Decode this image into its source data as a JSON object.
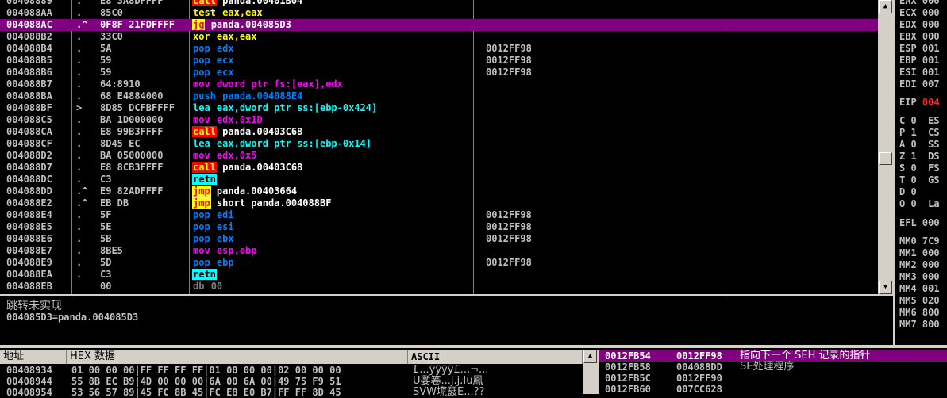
{
  "disasm": {
    "rows": [
      {
        "addr": "00408889",
        "mark": ".",
        "hex": "E8 3A8DFFFF",
        "mnem": "call",
        "mtype": "call",
        "ops": "panda.00401B04",
        "cmt": ""
      },
      {
        "addr": "004088AA",
        "mark": ".",
        "hex": "85C0",
        "mnem": "test",
        "mtype": "plain",
        "ops": "eax,eax",
        "cmt": ""
      },
      {
        "addr": "004088AC",
        "mark": ".^",
        "hex": "0F8F 21FDFFFF",
        "mnem": "jg",
        "mtype": "jmp",
        "ops": "panda.004085D3",
        "cmt": "",
        "sel": true
      },
      {
        "addr": "004088B2",
        "mark": ".",
        "hex": "33C0",
        "mnem": "xor",
        "mtype": "plain",
        "ops": "eax,eax",
        "cmt": ""
      },
      {
        "addr": "004088B4",
        "mark": ".",
        "hex": "5A",
        "mnem": "pop",
        "mtype": "pop",
        "ops": "edx",
        "cmt": "0012FF98"
      },
      {
        "addr": "004088B5",
        "mark": ".",
        "hex": "59",
        "mnem": "pop",
        "mtype": "pop",
        "ops": "ecx",
        "cmt": "0012FF98"
      },
      {
        "addr": "004088B6",
        "mark": ".",
        "hex": "59",
        "mnem": "pop",
        "mtype": "pop",
        "ops": "ecx",
        "cmt": "0012FF98"
      },
      {
        "addr": "004088B7",
        "mark": ".",
        "hex": "64:8910",
        "mnem": "mov",
        "mtype": "mov",
        "ops": "dword ptr fs:[eax],edx",
        "cmt": ""
      },
      {
        "addr": "004088BA",
        "mark": ".",
        "hex": "68 E4884000",
        "mnem": "push",
        "mtype": "push",
        "ops": "panda.004088E4",
        "cmt": ""
      },
      {
        "addr": "004088BF",
        "mark": ">",
        "hex": "8D85 DCFBFFFF",
        "mnem": "lea",
        "mtype": "plain",
        "ops": "eax,dword ptr ss:[ebp-0x424]",
        "cmt": ""
      },
      {
        "addr": "004088C5",
        "mark": ".",
        "hex": "BA 1D000000",
        "mnem": "mov",
        "mtype": "mov",
        "ops": "edx,0x1D",
        "cmt": ""
      },
      {
        "addr": "004088CA",
        "mark": ".",
        "hex": "E8 99B3FFFF",
        "mnem": "call",
        "mtype": "call",
        "ops": "panda.00403C68",
        "cmt": ""
      },
      {
        "addr": "004088CF",
        "mark": ".",
        "hex": "8D45 EC",
        "mnem": "lea",
        "mtype": "plain",
        "ops": "eax,dword ptr ss:[ebp-0x14]",
        "cmt": ""
      },
      {
        "addr": "004088D2",
        "mark": ".",
        "hex": "BA 05000000",
        "mnem": "mov",
        "mtype": "mov",
        "ops": "edx,0x5",
        "cmt": ""
      },
      {
        "addr": "004088D7",
        "mark": ".",
        "hex": "E8 8CB3FFFF",
        "mnem": "call",
        "mtype": "call",
        "ops": "panda.00403C68",
        "cmt": ""
      },
      {
        "addr": "004088DC",
        "mark": ".",
        "hex": "C3",
        "mnem": "retn",
        "mtype": "ret",
        "ops": "",
        "cmt": ""
      },
      {
        "addr": "004088DD",
        "mark": ".^",
        "hex": "E9 82ADFFFF",
        "mnem": "jmp",
        "mtype": "jmp",
        "ops": "panda.00403664",
        "cmt": ""
      },
      {
        "addr": "004088E2",
        "mark": ".^",
        "hex": "EB DB",
        "mnem": "jmp",
        "mtype": "jmp",
        "ops": "short panda.004088BF",
        "cmt": ""
      },
      {
        "addr": "004088E4",
        "mark": ".",
        "hex": "5F",
        "mnem": "pop",
        "mtype": "pop",
        "ops": "edi",
        "cmt": "0012FF98"
      },
      {
        "addr": "004088E5",
        "mark": ".",
        "hex": "5E",
        "mnem": "pop",
        "mtype": "pop",
        "ops": "esi",
        "cmt": "0012FF98"
      },
      {
        "addr": "004088E6",
        "mark": ".",
        "hex": "5B",
        "mnem": "pop",
        "mtype": "pop",
        "ops": "ebx",
        "cmt": "0012FF98"
      },
      {
        "addr": "004088E7",
        "mark": ".",
        "hex": "8BE5",
        "mnem": "mov",
        "mtype": "mov",
        "ops": "esp,ebp",
        "cmt": ""
      },
      {
        "addr": "004088E9",
        "mark": ".",
        "hex": "5D",
        "mnem": "pop",
        "mtype": "pop",
        "ops": "ebp",
        "cmt": "0012FF98"
      },
      {
        "addr": "004088EA",
        "mark": ".",
        "hex": "C3",
        "mnem": "retn",
        "mtype": "ret",
        "ops": "",
        "cmt": ""
      },
      {
        "addr": "004088EB",
        "mark": "",
        "hex": "00",
        "mnem": "db",
        "mtype": "db",
        "ops": "00",
        "cmt": ""
      }
    ]
  },
  "info": {
    "line1": "跳转未实现",
    "line2": "004085D3=panda.004085D3"
  },
  "registers": [
    {
      "t": "EAX 000",
      "red": false
    },
    {
      "t": "ECX 000",
      "red": false
    },
    {
      "t": "EDX 000",
      "red": false
    },
    {
      "t": "EBX 000",
      "red": false
    },
    {
      "t": "ESP 001",
      "red": false
    },
    {
      "t": "EBP 001",
      "red": false
    },
    {
      "t": "ESI 001",
      "red": false
    },
    {
      "t": "EDI 007",
      "red": false
    },
    {
      "t": "EIP 004",
      "red": true
    },
    {
      "t": "C 0  ES",
      "red": false
    },
    {
      "t": "P 1  CS",
      "red": false
    },
    {
      "t": "A 0  SS",
      "red": false
    },
    {
      "t": "Z 1  DS",
      "red": false
    },
    {
      "t": "S 0  FS",
      "red": false
    },
    {
      "t": "T 0  GS",
      "red": false
    },
    {
      "t": "D 0",
      "red": false
    },
    {
      "t": "O 0  La",
      "red": false
    },
    {
      "t": "EFL 000",
      "red": false
    },
    {
      "t": "MM0 7C9",
      "red": false
    },
    {
      "t": "MM1 000",
      "red": false
    },
    {
      "t": "MM2 000",
      "red": false
    },
    {
      "t": "MM3 000",
      "red": false
    },
    {
      "t": "MM4 001",
      "red": false
    },
    {
      "t": "MM5 020",
      "red": false
    },
    {
      "t": "MM6 800",
      "red": false
    },
    {
      "t": "MM7 800",
      "red": false
    }
  ],
  "dump": {
    "headers": {
      "addr": "地址",
      "hex": "HEX 数据",
      "ascii": "ASCII"
    },
    "rows": [
      {
        "addr": "00408934",
        "hex": "01 00 00 00|FF FF FF FF|01 00 00 00|02 00 00 00",
        "ascii": "£...ÿÿÿÿ£...¬..."
      },
      {
        "addr": "00408944",
        "hex": "55 8B EC B9|4D 00 00 00|6A 00 6A 00|49 75 F9 51",
        "ascii": "U嬱箞...j.j.Iu鳳"
      },
      {
        "addr": "00408954",
        "hex": "53 56 57 89|45 FC 8B 45|FC E8 E0 B7|FF FF 8D 45",
        "ascii": "SVW塃鼖E...??"
      }
    ]
  },
  "stack": {
    "rows": [
      {
        "addr": "0012FB54",
        "val": "0012FF98",
        "cmt": "指向下一个 SEH 记录的指针",
        "sel": true
      },
      {
        "addr": "0012FB58",
        "val": "004088DD",
        "cmt": "SE处理程序",
        "sel": false
      },
      {
        "addr": "0012FB5C",
        "val": "0012FF90",
        "cmt": "",
        "sel": false
      },
      {
        "addr": "0012FB60",
        "val": "007CC628",
        "cmt": "",
        "sel": false
      }
    ]
  }
}
